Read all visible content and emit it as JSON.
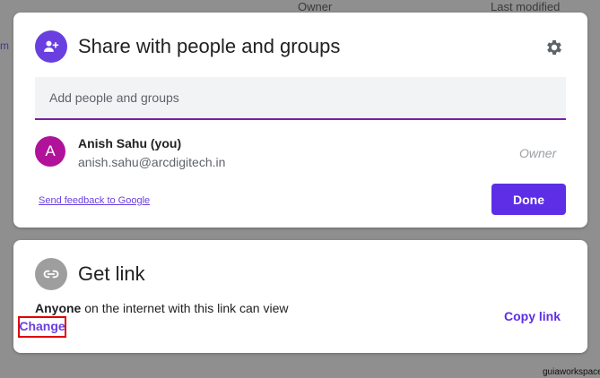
{
  "background": {
    "columns": {
      "owner": "Owner",
      "last_modified": "Last modified"
    },
    "left_fragment": "m"
  },
  "share_dialog": {
    "title": "Share with people and groups",
    "add_placeholder": "Add people and groups",
    "user": {
      "avatar_letter": "A",
      "name": "Anish Sahu (you)",
      "email": "anish.sahu@arcdigitech.in",
      "role": "Owner"
    },
    "feedback_link": "Send feedback to Google",
    "done_label": "Done"
  },
  "get_link": {
    "title": "Get link",
    "access_bold": "Anyone",
    "access_rest": " on the internet with this link can view",
    "change_label": "Change",
    "copy_label": "Copy link"
  },
  "watermark": "guiaworkspace",
  "colors": {
    "accent": "#5d2ee6",
    "avatar": "#b0139a",
    "highlight_box": "#e00000",
    "link_icon_bg": "#9e9e9e"
  }
}
